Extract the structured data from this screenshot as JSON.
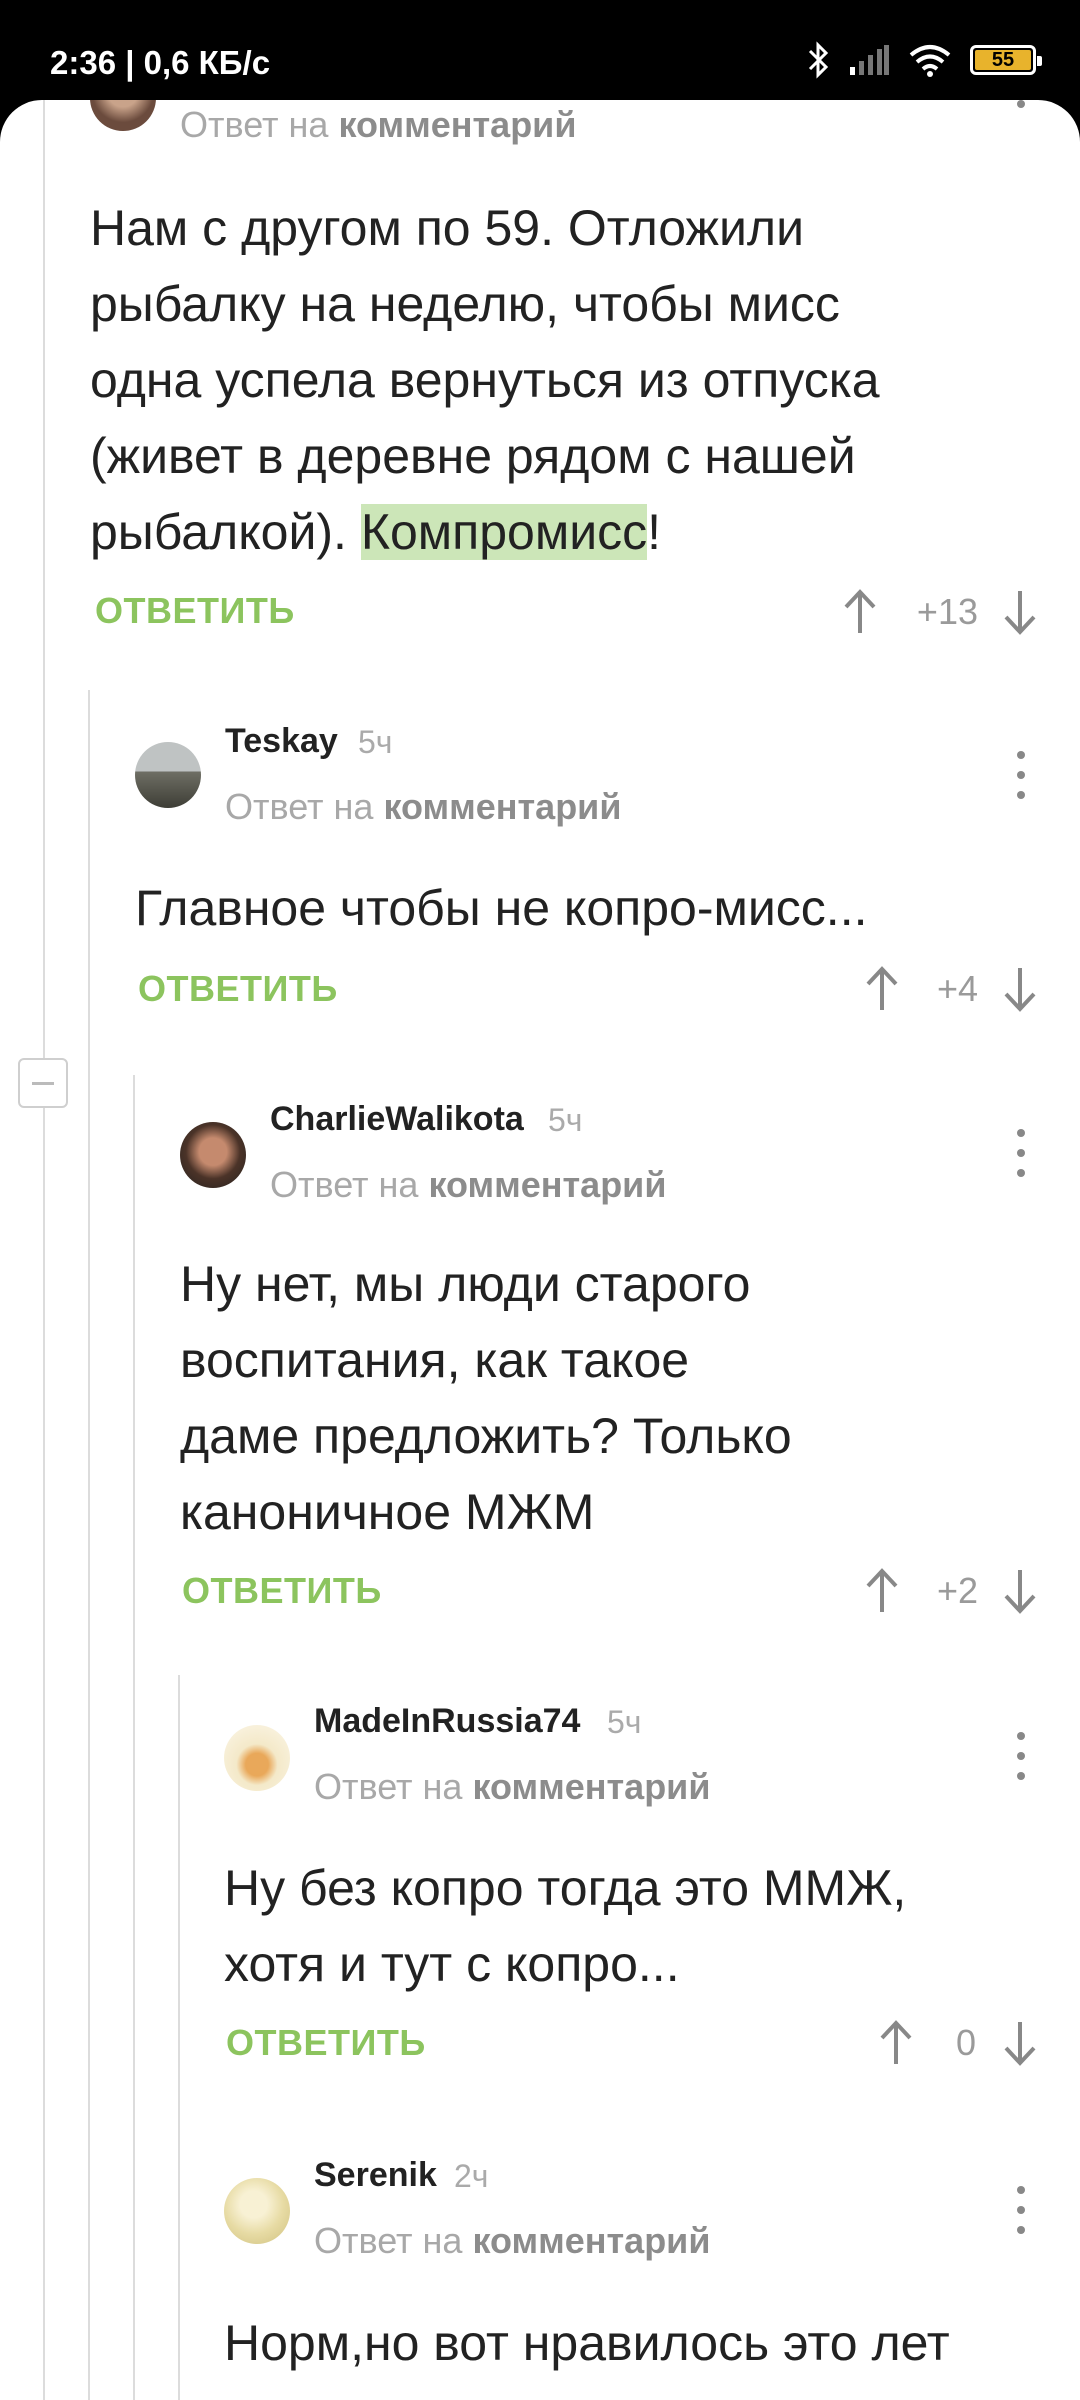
{
  "status": {
    "time": "2:36 | 0,6 КБ/с",
    "battery": "55",
    "battery_color": "#e8b32c"
  },
  "reply_prefix": "Ответ на",
  "reply_target": "комментарий",
  "reply_label": "ОТВЕТИТЬ",
  "comments": [
    {
      "author": "",
      "time": "",
      "text_lines": [
        "Нам с другом по 59. Отложили",
        "рыбалку на неделю, чтобы мисс",
        "одна успела вернуться из отпуска",
        "(живет в деревне рядом с нашей"
      ],
      "text_last_prefix": "рыбалкой). ",
      "text_highlight": "Компромисс",
      "text_last_suffix": "!",
      "score": "+13"
    },
    {
      "author": "Teskay",
      "time": "5ч",
      "text_lines": [
        "Главное чтобы не копро-мисс..."
      ],
      "score": "+4"
    },
    {
      "author": "CharlieWalikota",
      "time": "5ч",
      "text_lines": [
        "Ну нет, мы люди старого",
        "воспитания, как такое",
        "даме предложить? Только",
        "каноничное МЖМ"
      ],
      "score": "+2"
    },
    {
      "author": "MadeInRussia74",
      "time": "5ч",
      "text_lines": [
        "Ну без копро тогда это ММЖ,",
        "хотя и тут с копро..."
      ],
      "score": "0"
    },
    {
      "author": "Serenik",
      "time": "2ч",
      "text_lines": [
        "Норм,но вот нравилось это лет"
      ],
      "score": ""
    }
  ],
  "colors": {
    "accent": "#8cc45e",
    "highlight": "#cce6b8"
  }
}
